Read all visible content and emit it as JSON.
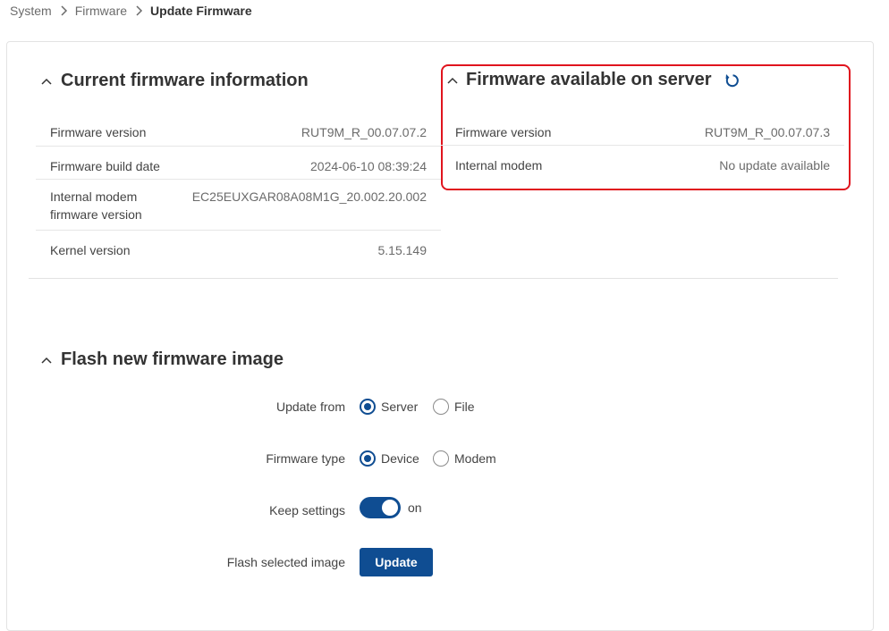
{
  "breadcrumb": {
    "items": [
      "System",
      "Firmware"
    ],
    "current": "Update Firmware"
  },
  "current_info": {
    "title": "Current firmware information",
    "rows": [
      {
        "key": "Firmware version",
        "value": "RUT9M_R_00.07.07.2"
      },
      {
        "key": "Firmware build date",
        "value": "2024-06-10 08:39:24"
      },
      {
        "key": "Internal modem firmware version",
        "value": "EC25EUXGAR08A08M1G_20.002.20.002"
      },
      {
        "key": "Kernel version",
        "value": "5.15.149"
      }
    ]
  },
  "server_info": {
    "title": "Firmware available on server",
    "rows": [
      {
        "key": "Firmware version",
        "value": "RUT9M_R_00.07.07.3"
      },
      {
        "key": "Internal modem",
        "value": "No update available"
      }
    ]
  },
  "flash": {
    "title": "Flash new firmware image",
    "update_from": {
      "label": "Update from",
      "options": [
        "Server",
        "File"
      ],
      "selected": "Server"
    },
    "firmware_type": {
      "label": "Firmware type",
      "options": [
        "Device",
        "Modem"
      ],
      "selected": "Device"
    },
    "keep_settings": {
      "label": "Keep settings",
      "state": "on"
    },
    "flash_image": {
      "label": "Flash selected image",
      "button": "Update"
    }
  },
  "colors": {
    "accent": "#0f4d92",
    "highlight": "#e0141e"
  }
}
